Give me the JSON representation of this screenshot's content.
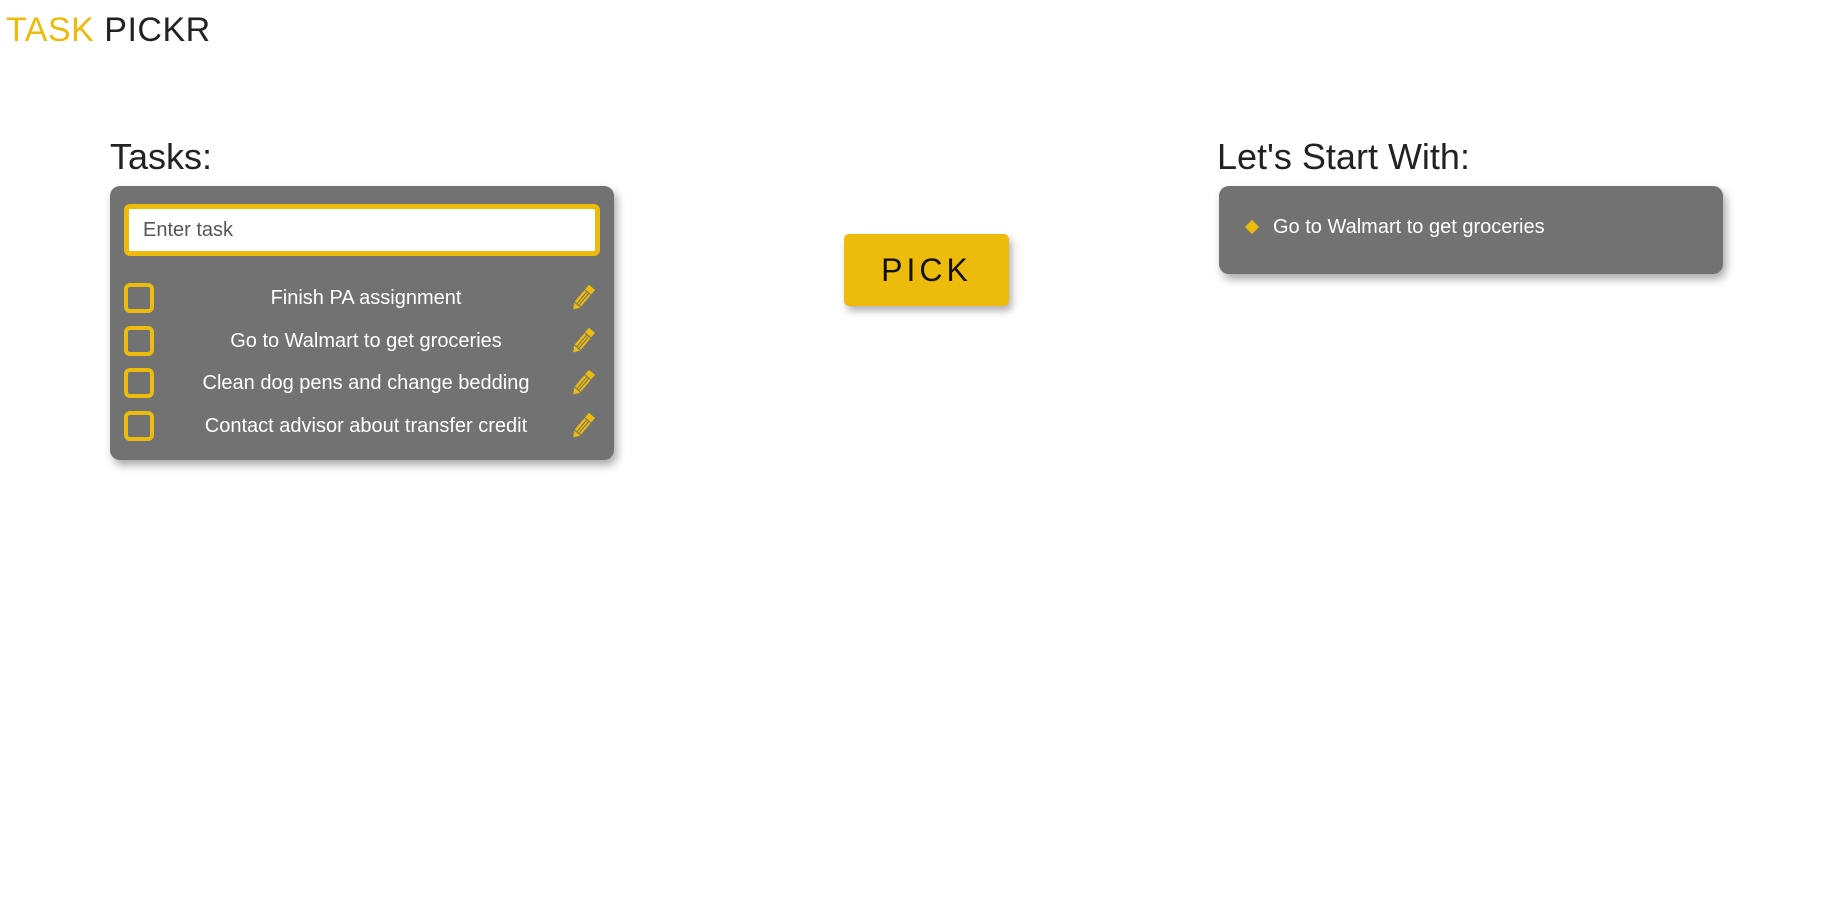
{
  "brand": {
    "part1": "TASK",
    "part2": "PICKR"
  },
  "tasks": {
    "title": "Tasks:",
    "input_placeholder": "Enter task",
    "items": [
      {
        "label": "Finish PA assignment",
        "checked": false
      },
      {
        "label": "Go to Walmart to get groceries",
        "checked": false
      },
      {
        "label": "Clean dog pens and change bedding",
        "checked": false
      },
      {
        "label": "Contact advisor about transfer credit",
        "checked": false
      }
    ]
  },
  "pick_button": {
    "label": "PICK"
  },
  "start": {
    "title": "Let's Start With:",
    "item": "Go to Walmart to get groceries"
  },
  "icons": {
    "edit": "pencil-icon",
    "bullet": "diamond-bullet-icon"
  },
  "colors": {
    "accent": "#edbb0c",
    "panel": "#727272",
    "text_dark": "#222222",
    "text_light": "#ffffff"
  }
}
